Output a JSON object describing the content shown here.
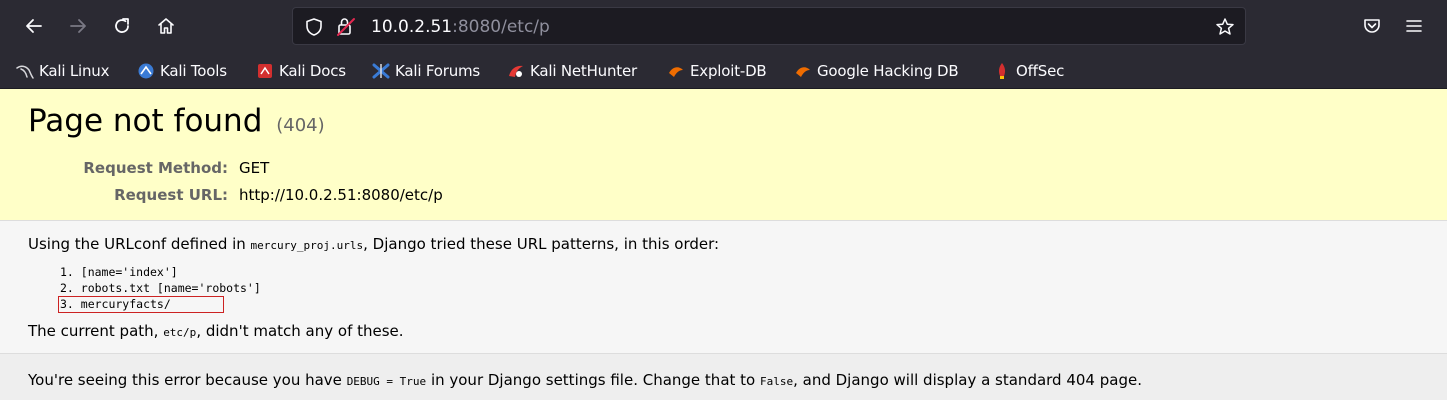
{
  "browser": {
    "url_host": "10.0.2.51",
    "url_path": ":8080/etc/p",
    "icons": [
      "back-icon",
      "forward-icon",
      "reload-icon",
      "home-icon",
      "shield-icon",
      "lock-warning-icon",
      "star-icon",
      "pocket-icon",
      "menu-icon"
    ],
    "bookmarks": [
      {
        "label": "Kali Linux",
        "icon": "kali-dragon-icon"
      },
      {
        "label": "Kali Tools",
        "icon": "kali-tools-icon"
      },
      {
        "label": "Kali Docs",
        "icon": "kali-docs-icon"
      },
      {
        "label": "Kali Forums",
        "icon": "kali-forums-icon"
      },
      {
        "label": "Kali NetHunter",
        "icon": "kali-nethunter-icon"
      },
      {
        "label": "Exploit-DB",
        "icon": "exploit-db-icon"
      },
      {
        "label": "Google Hacking DB",
        "icon": "ghdb-icon"
      },
      {
        "label": "OffSec",
        "icon": "offsec-icon"
      }
    ]
  },
  "page": {
    "title": "Page not found",
    "status_code": "(404)",
    "request_method_label": "Request Method:",
    "request_method": "GET",
    "request_url_label": "Request URL:",
    "request_url": "http://10.0.2.51:8080/etc/p",
    "urlconf_prefix": "Using the URLconf defined in ",
    "urlconf_module": "mercury_proj.urls",
    "urlconf_suffix": ", Django tried these URL patterns, in this order:",
    "patterns": [
      "1. [name='index']",
      "2. robots.txt [name='robots']",
      "3. mercuryfacts/"
    ],
    "current_path_prefix": "The current path, ",
    "current_path": "etc/p",
    "current_path_suffix": ", didn't match any of these.",
    "explanation_prefix": "You're seeing this error because you have ",
    "debug_code": "DEBUG = True",
    "explanation_middle": " in your Django settings file. Change that to ",
    "false_code": "False",
    "explanation_suffix": ", and Django will display a standard 404 page."
  },
  "colors": {
    "chrome_bg": "#2b2a33",
    "urlbar_bg": "#1c1b22",
    "summary_bg": "#ffffc8",
    "info_bg": "#f6f6f6",
    "explanation_bg": "#eeeeee",
    "highlight_border": "#cc2222"
  }
}
